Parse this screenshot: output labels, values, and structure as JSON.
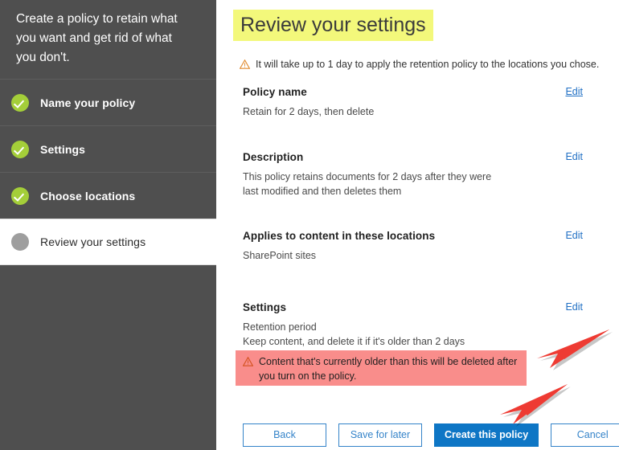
{
  "sidebar": {
    "intro": "Create a policy to retain what you want and get rid of what you don't.",
    "steps": [
      {
        "label": "Name your policy",
        "state": "done",
        "icon": "check-circle-icon"
      },
      {
        "label": "Settings",
        "state": "done",
        "icon": "check-circle-icon"
      },
      {
        "label": "Choose locations",
        "state": "done",
        "icon": "check-circle-icon"
      },
      {
        "label": "Review your settings",
        "state": "current",
        "icon": "filled-circle-icon"
      }
    ]
  },
  "main": {
    "title": "Review your settings",
    "info_banner": {
      "icon": "warning-triangle-icon",
      "text": "It will take up to 1 day to apply the retention policy to the locations you chose."
    },
    "sections": [
      {
        "heading": "Policy name",
        "body": "Retain for 2 days, then delete",
        "edit_label": "Edit"
      },
      {
        "heading": "Description",
        "body": "This policy retains documents for 2 days after they were last modified and then deletes them",
        "edit_label": "Edit"
      },
      {
        "heading": "Applies to content in these locations",
        "body": "SharePoint sites",
        "edit_label": "Edit"
      },
      {
        "heading": "Settings",
        "body": "Retention period\nKeep content, and delete it if it's older than 2 days",
        "body_line1": "Retention period",
        "body_line2": "Keep content, and delete it if it's older than 2 days",
        "edit_label": "Edit"
      }
    ],
    "alert": {
      "icon": "warning-triangle-icon",
      "text": "Content that's currently older than this will be deleted after you turn on the policy."
    },
    "buttons": {
      "back": "Back",
      "save_for_later": "Save for later",
      "create": "Create this policy",
      "cancel": "Cancel"
    }
  },
  "annotations": {
    "arrows": [
      {
        "name": "arrow-pointing-to-alert",
        "color": "#ee3b33",
        "direction": "down-left"
      },
      {
        "name": "arrow-pointing-to-create-button",
        "color": "#ee3b33",
        "direction": "down-left"
      }
    ]
  },
  "colors": {
    "sidebar_bg": "#4f4f4f",
    "step_done": "#a4ce39",
    "step_pending": "#9e9e9e",
    "title_highlight": "#f3f87b",
    "alert_bg": "#f98d8b",
    "primary_button": "#0e76c5",
    "link": "#1f6fc4",
    "annotation_red": "#ee3b33"
  }
}
